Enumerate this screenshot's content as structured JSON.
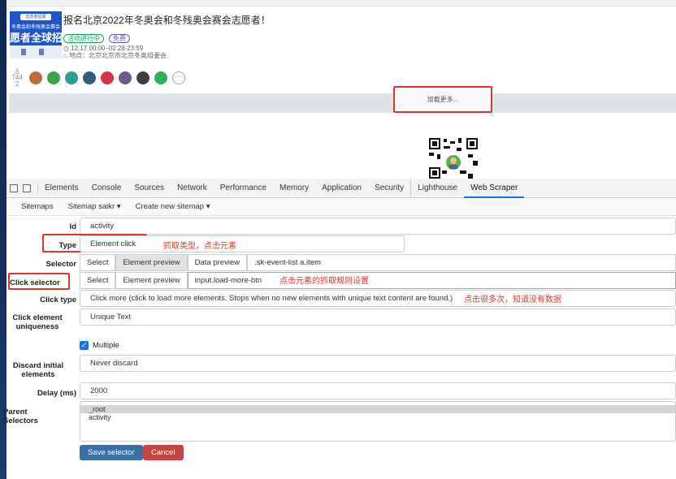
{
  "event": {
    "card_ribbon": "志愿者招募",
    "card_subtitle": "冬奥会和冬残奥会赛会",
    "card_big_text": "愿者全球招",
    "title": "报名北京2022年冬奥会和冬残奥会赛会志愿者！",
    "status_badge": "活动进行中",
    "free_badge": "免费",
    "time": "◷ 12.17 00:00–02.28 23:59",
    "location": "⌂ 地点：北京北京市北京冬奥组委会",
    "participant_count_top": "744",
    "participant_count_bottom": "2",
    "avatar_colors": [
      "#c26a3a",
      "#3aa14c",
      "#2aa198",
      "#2f5d7a",
      "#d6334a",
      "#6b5a8a",
      "#3e3e3e",
      "#2fb15a",
      "#4bb443"
    ],
    "more_label": "···",
    "load_more_label": "加载更多..."
  },
  "devtools": {
    "tabs": [
      "Elements",
      "Console",
      "Sources",
      "Network",
      "Performance",
      "Memory",
      "Application",
      "Security",
      "Lighthouse",
      "Web Scraper"
    ],
    "active_tab": "Web Scraper",
    "sitemap_nav": [
      "Sitemaps",
      "Sitemap saikr ▾",
      "Create new sitemap ▾"
    ]
  },
  "form": {
    "id_label": "Id",
    "id_value": "activity",
    "type_label": "Type",
    "type_value": "Element click",
    "type_annotation": "抓取类型，点击元素",
    "selector_label": "Selector",
    "selector_buttons": [
      "Select",
      "Element preview",
      "Data preview"
    ],
    "selector_value": ".sk-event-list a.item",
    "click_selector_label": "Click selector",
    "click_selector_buttons": [
      "Select",
      "Element preview"
    ],
    "click_selector_value": "input.load-more-btn",
    "click_selector_annotation": "点击元素的抓取规则设置",
    "click_type_label": "Click type",
    "click_type_value": "Click more (click to load more elements. Stops when no new elements with unique text content are found.)",
    "click_type_annotation": "点击很多次，知道没有数据",
    "uniqueness_label_1": "Click element",
    "uniqueness_label_2": "uniqueness",
    "uniqueness_value": "Unique Text",
    "multiple_label": "Multiple",
    "discard_label_1": "Discard initial",
    "discard_label_2": "elements",
    "discard_value": "Never discard",
    "delay_label": "Delay (ms)",
    "delay_value": "2000",
    "parent_label": "Parent Selectors",
    "parent_options": [
      "_root",
      "activity"
    ],
    "save_label": "Save selector",
    "cancel_label": "Cancel"
  }
}
